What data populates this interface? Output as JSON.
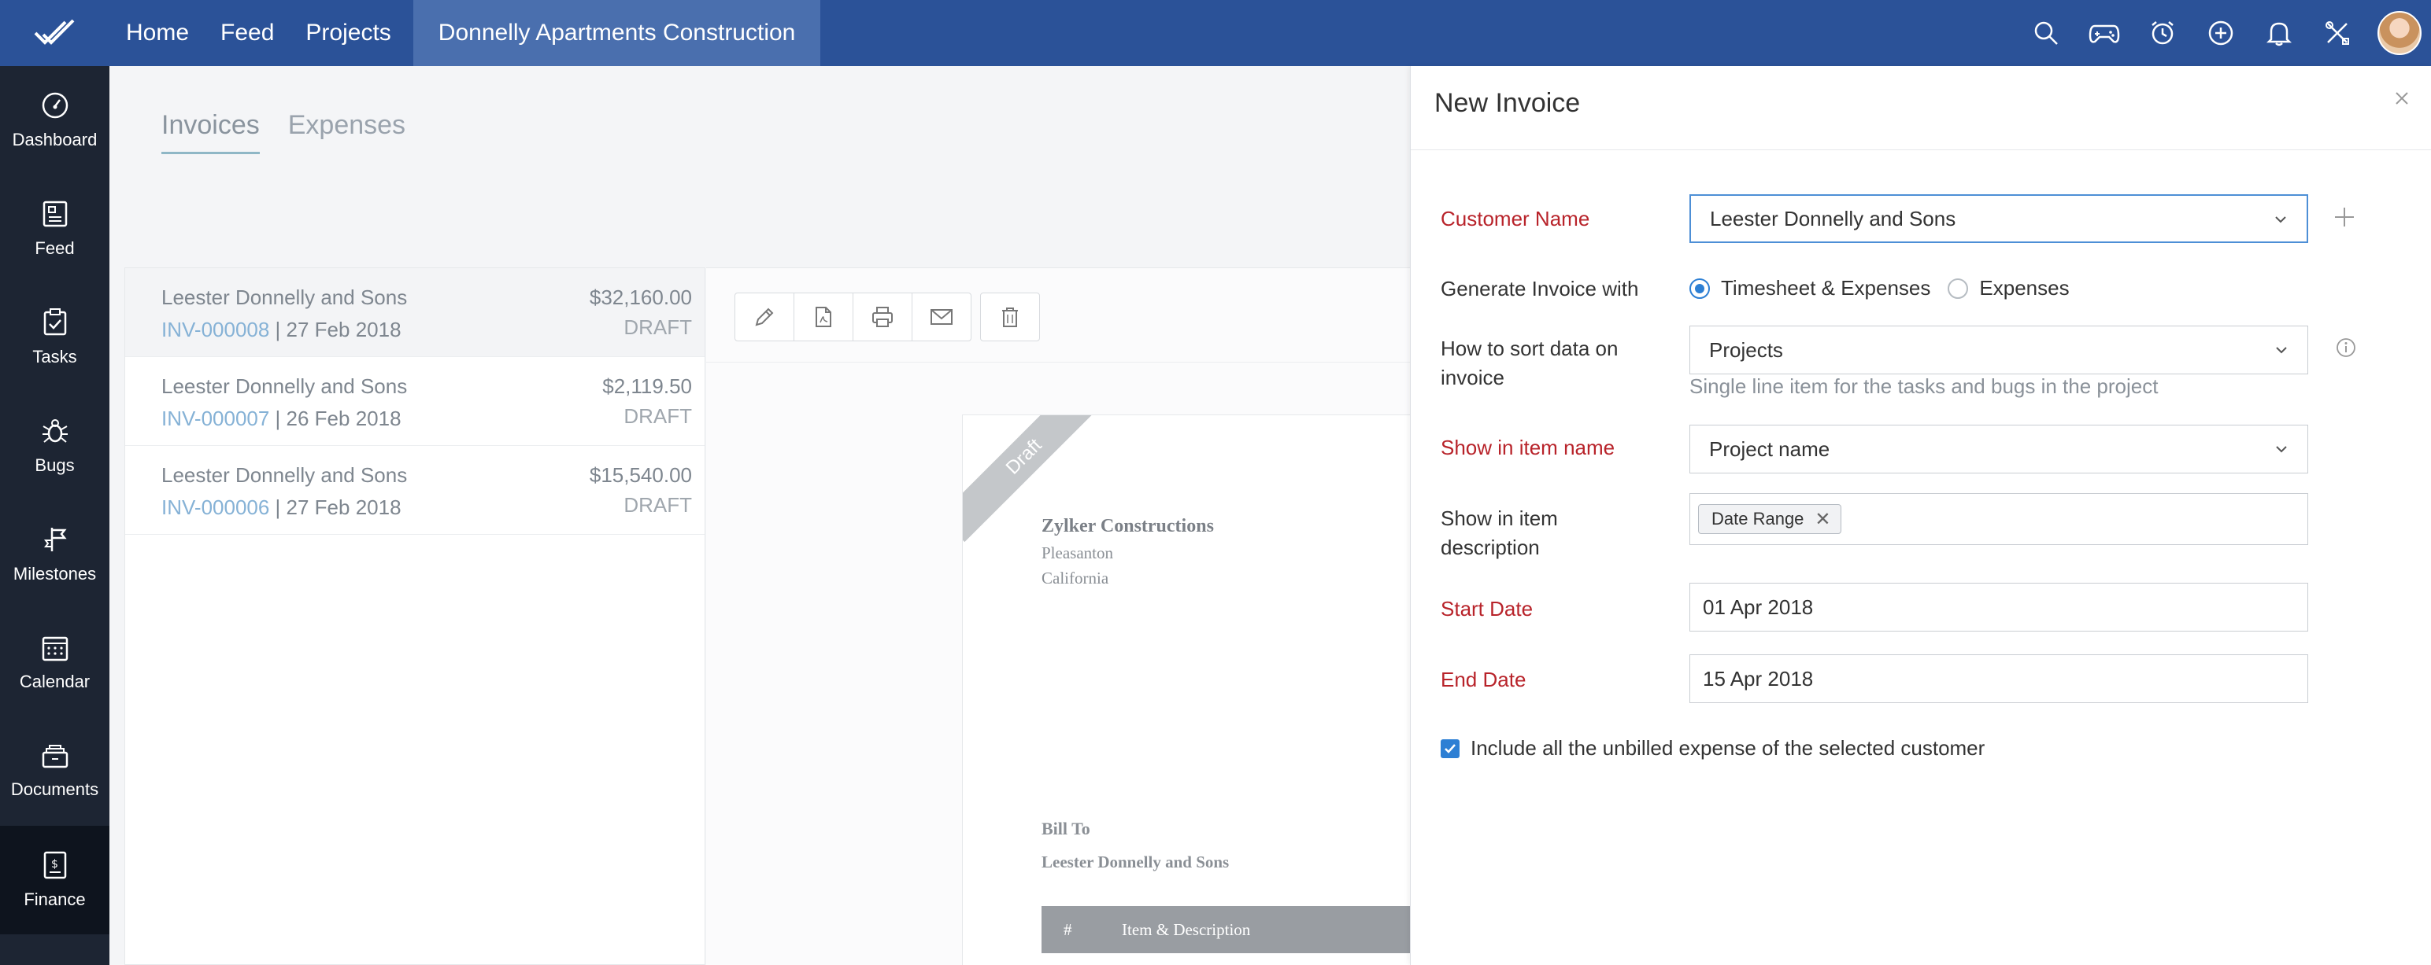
{
  "topbar": {
    "nav": [
      "Home",
      "Feed",
      "Projects"
    ],
    "active_project": "Donnelly Apartments Construction"
  },
  "sidebar": {
    "items": [
      {
        "label": "Dashboard",
        "icon": "dashboard-icon"
      },
      {
        "label": "Feed",
        "icon": "feed-icon"
      },
      {
        "label": "Tasks",
        "icon": "tasks-icon"
      },
      {
        "label": "Bugs",
        "icon": "bug-icon"
      },
      {
        "label": "Milestones",
        "icon": "milestone-icon"
      },
      {
        "label": "Calendar",
        "icon": "calendar-icon"
      },
      {
        "label": "Documents",
        "icon": "documents-icon"
      },
      {
        "label": "Finance",
        "icon": "finance-icon"
      }
    ]
  },
  "tabs": [
    "Invoices",
    "Expenses"
  ],
  "invoices": [
    {
      "customer": "Leester Donnelly and Sons",
      "number": "INV-000008",
      "date": " | 27 Feb 2018",
      "amount": "$32,160.00",
      "status": "DRAFT"
    },
    {
      "customer": "Leester Donnelly and Sons",
      "number": "INV-000007",
      "date": " | 26 Feb 2018",
      "amount": "$2,119.50",
      "status": "DRAFT"
    },
    {
      "customer": "Leester Donnelly and Sons",
      "number": "INV-000006",
      "date": " | 27 Feb 2018",
      "amount": "$15,540.00",
      "status": "DRAFT"
    }
  ],
  "preview": {
    "ribbon": "Draft",
    "company": "Zylker Constructions",
    "address1": "Pleasanton",
    "address2": "California",
    "bill_to": "Bill To",
    "bill_customer": "Leester Donnelly and Sons",
    "col_hash": "#",
    "col_item": "Item & Description"
  },
  "form": {
    "title": "New Invoice",
    "customer_label": "Customer Name",
    "customer_value": "Leester Donnelly and Sons",
    "generate_label": "Generate Invoice with",
    "generate_opt1": "Timesheet & Expenses",
    "generate_opt2": "Expenses",
    "sort_label_1": "How to sort data on",
    "sort_label_2": "invoice",
    "sort_value": "Projects",
    "sort_hint": "Single line item for the tasks and bugs in the project",
    "itemname_label": "Show in item name",
    "itemname_value": "Project name",
    "itemdesc_label_1": "Show in item",
    "itemdesc_label_2": "description",
    "itemdesc_chip": "Date Range",
    "start_label": "Start Date",
    "start_value": "01 Apr 2018",
    "end_label": "End Date",
    "end_value": "15 Apr 2018",
    "include_label": "Include all the unbilled expense of the selected customer"
  },
  "colors": {
    "topbar": "#2b5298",
    "sidebar": "#1d2533",
    "required": "#b8232a",
    "accent": "#2d7fd4"
  }
}
